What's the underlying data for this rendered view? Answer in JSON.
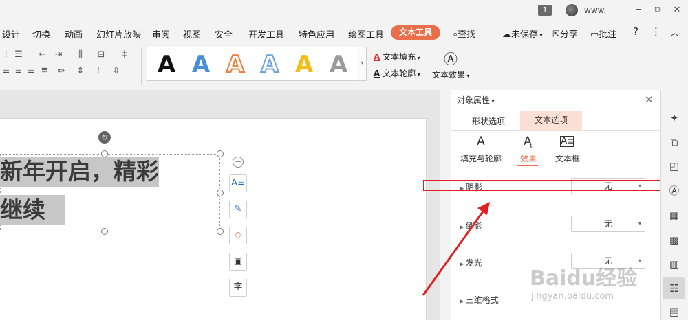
{
  "titlebar": {
    "badge": "1",
    "user": "www.",
    "minimize": "─",
    "restore": "⧉",
    "close": "✕"
  },
  "menu": {
    "items": [
      "设计",
      "切换",
      "动画",
      "幻灯片放映",
      "审阅",
      "视图",
      "安全",
      "开发工具",
      "特色应用",
      "绘图工具"
    ],
    "active": "文本工具",
    "search": "查找",
    "unsaved": "未保存",
    "share": "分享",
    "comment": "批注",
    "help": "?",
    "more": "⋮",
    "collapse": "︿"
  },
  "ribbon": {
    "text_fill": "文本填充",
    "text_outline": "文本轮廓",
    "text_effect": "文本效果",
    "styles": [
      "A",
      "A",
      "A",
      "A",
      "A",
      "A"
    ],
    "style_colors": [
      "#111111",
      "#4a8ed6",
      "#ef7f3b",
      "#6fa4dc",
      "#f2bd1c",
      "#9a9a9a"
    ]
  },
  "slide": {
    "line1": "新年开启，精彩",
    "line2": "继续",
    "collapse": "−"
  },
  "panel": {
    "title": "对象属性",
    "tab_shape": "形状选项",
    "tab_text": "文本选项",
    "sub_fill": "填充与轮廓",
    "sub_effect": "效果",
    "sub_textbox": "文本框",
    "rows": [
      {
        "label": "阴影",
        "value": "无"
      },
      {
        "label": "倒影",
        "value": "无"
      },
      {
        "label": "发光",
        "value": "无"
      },
      {
        "label": "三维格式",
        "value": ""
      }
    ]
  },
  "watermark": {
    "brand": "Baidu经验",
    "url": "jingyan.baidu.com"
  },
  "colors": {
    "accent": "#e96f4a",
    "highlight": "#e02020",
    "selection": "#c7c7c7"
  }
}
